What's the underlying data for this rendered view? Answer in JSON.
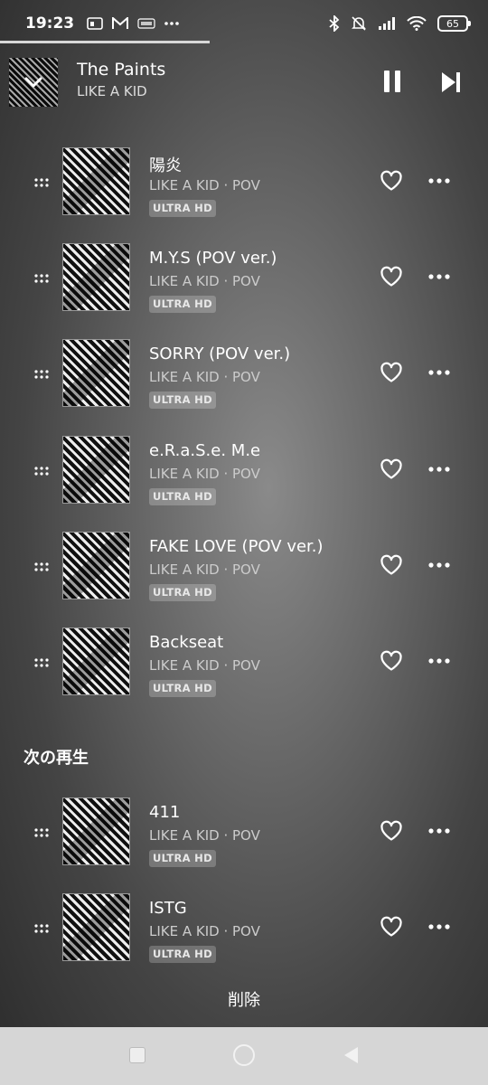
{
  "status_bar": {
    "time": "19:23",
    "left_icons": [
      "cast-icon",
      "gmail-icon",
      "app-icon",
      "more-dots-icon"
    ],
    "battery": "65"
  },
  "now_playing": {
    "title": "The Paints",
    "artist": "LIKE A KID"
  },
  "queue": {
    "tracks": [
      {
        "title": "陽炎",
        "subtitle": "LIKE A KID · POV",
        "badge": "ULTRA HD"
      },
      {
        "title": "M.Y.S (POV ver.)",
        "subtitle": "LIKE A KID · POV",
        "badge": "ULTRA HD"
      },
      {
        "title": "SORRY (POV ver.)",
        "subtitle": "LIKE A KID · POV",
        "badge": "ULTRA HD"
      },
      {
        "title": "e.R.a.S.e. M.e",
        "subtitle": "LIKE A KID · POV",
        "badge": "ULTRA HD"
      },
      {
        "title": "FAKE LOVE (POV ver.)",
        "subtitle": "LIKE A KID · POV",
        "badge": "ULTRA HD"
      },
      {
        "title": "Backseat",
        "subtitle": "LIKE A KID · POV",
        "badge": "ULTRA HD"
      }
    ],
    "up_next_heading": "次の再生",
    "up_next": [
      {
        "title": "411",
        "subtitle": "LIKE A KID · POV",
        "badge": "ULTRA HD"
      },
      {
        "title": "ISTG",
        "subtitle": "LIKE A KID · POV",
        "badge": "ULTRA HD"
      }
    ],
    "delete_label": "削除"
  },
  "colors": {
    "background_center": "#8a8a8a",
    "background_edge": "#2c2c2c",
    "badge_bg": "rgba(255,255,255,0.22)",
    "nav_bar": "#d6d6d6"
  }
}
